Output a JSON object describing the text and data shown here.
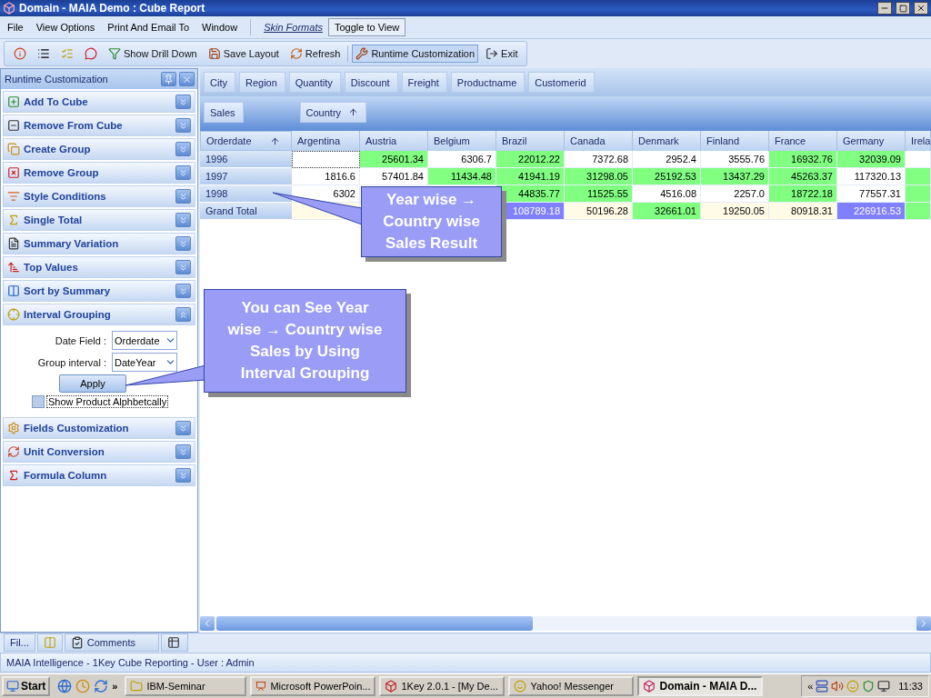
{
  "window": {
    "title": "Domain - MAIA Demo : Cube Report"
  },
  "menu": [
    {
      "label": "File"
    },
    {
      "label": "View Options"
    },
    {
      "label": "Print And Email To"
    },
    {
      "label": "Window"
    }
  ],
  "skin_formats": "Skin Formats",
  "toggle_button": "Toggle to View",
  "toolbar": [
    {
      "label": "Show Drill Down",
      "selected": false
    },
    {
      "label": "Save Layout",
      "selected": false
    },
    {
      "label": "Refresh",
      "selected": false
    },
    {
      "label": "Runtime Customization",
      "selected": true
    },
    {
      "label": "Exit",
      "selected": false
    }
  ],
  "panel": {
    "title": "Runtime Customization",
    "sections": [
      {
        "label": "Add To Cube",
        "expanded": false
      },
      {
        "label": "Remove From Cube",
        "expanded": false
      },
      {
        "label": "Create Group",
        "expanded": false
      },
      {
        "label": "Remove Group",
        "expanded": false
      },
      {
        "label": "Style Conditions",
        "expanded": false
      },
      {
        "label": "Single Total",
        "expanded": false
      },
      {
        "label": "Summary Variation",
        "expanded": false
      },
      {
        "label": "Top Values",
        "expanded": false
      },
      {
        "label": "Sort by Summary",
        "expanded": false
      },
      {
        "label": "Interval Grouping",
        "expanded": true
      },
      {
        "label": "Fields Customization",
        "expanded": false
      },
      {
        "label": "Unit Conversion",
        "expanded": false
      },
      {
        "label": "Formula Column",
        "expanded": false
      }
    ]
  },
  "interval_grouping": {
    "date_field": {
      "label": "Date Field :",
      "value": "Orderdate"
    },
    "group_interval": {
      "label": "Group interval :",
      "value": "DateYear"
    },
    "apply": "Apply",
    "sort_option": {
      "label": "Show Product Alphbetcally",
      "checked": false
    }
  },
  "field_list": [
    "City",
    "Region",
    "Quantity",
    "Discount",
    "Freight",
    "Productname",
    "Customerid"
  ],
  "data_field": "Sales",
  "column_field": "Country",
  "row_field": "Orderdate",
  "grid": {
    "columns": [
      "Argentina",
      "Austria",
      "Belgium",
      "Brazil",
      "Canada",
      "Denmark",
      "Finland",
      "France",
      "Germany",
      "Irela"
    ],
    "rows": [
      {
        "label": "1996",
        "cells": [
          {
            "color": "#ffffff",
            "focused": true
          },
          {
            "value": "25601.34",
            "color": "#80ff80"
          },
          {
            "value": "6306.7",
            "color": "#ffffff"
          },
          {
            "value": "22012.22",
            "color": "#80ff80"
          },
          {
            "value": "7372.68",
            "color": "#ffffff"
          },
          {
            "value": "2952.4",
            "color": "#ffffff"
          },
          {
            "value": "3555.76",
            "color": "#ffffff"
          },
          {
            "value": "16932.76",
            "color": "#80ff80"
          },
          {
            "value": "32039.09",
            "color": "#80ff80"
          },
          {
            "color": "#ffffff"
          }
        ]
      },
      {
        "label": "1997",
        "cells": [
          {
            "value": "1816.6",
            "color": "#ffffff"
          },
          {
            "value": "57401.84",
            "color": "#ffffff"
          },
          {
            "value": "11434.48",
            "color": "#80ff80"
          },
          {
            "value": "41941.19",
            "color": "#80ff80"
          },
          {
            "value": "31298.05",
            "color": "#80ff80"
          },
          {
            "value": "25192.53",
            "color": "#80ff80"
          },
          {
            "value": "13437.29",
            "color": "#80ff80"
          },
          {
            "value": "45263.37",
            "color": "#80ff80"
          },
          {
            "value": "117320.13",
            "color": "#ffffff"
          },
          {
            "color": "#80ff80"
          }
        ]
      },
      {
        "label": "1998",
        "cells": [
          {
            "value": "6302",
            "color": "#ffffff"
          },
          {},
          {},
          {
            "value": "44835.77",
            "color": "#80ff80"
          },
          {
            "value": "11525.55",
            "color": "#80ff80"
          },
          {
            "value": "4516.08",
            "color": "#ffffff"
          },
          {
            "value": "2257.0",
            "color": "#ffffff"
          },
          {
            "value": "18722.18",
            "color": "#80ff80"
          },
          {
            "value": "77557.31",
            "color": "#ffffff"
          },
          {
            "color": "#80ff80"
          }
        ]
      },
      {
        "label": "Grand Total",
        "cells": [
          {
            "color": "#fffbe6"
          },
          {},
          {},
          {
            "value": "108789.18",
            "color": "#8080ff"
          },
          {
            "value": "50196.28",
            "color": "#fffbe6"
          },
          {
            "value": "32661.01",
            "color": "#80ff80"
          },
          {
            "value": "19250.05",
            "color": "#fffbe6"
          },
          {
            "value": "80918.31",
            "color": "#fffbe6"
          },
          {
            "value": "226916.53",
            "color": "#8080ff"
          },
          {
            "color": "#80ff80"
          }
        ]
      }
    ]
  },
  "callouts": [
    {
      "text": "Year wise → Country wise Sales Result"
    },
    {
      "text": "You can See Year wise → Country wise Sales by Using Interval Grouping"
    }
  ],
  "bottom_tabs": [
    {
      "label": "Fil...",
      "selected": false
    },
    {
      "label": "Comments",
      "selected": false
    }
  ],
  "status": "MAIA Intelligence - 1Key Cube Reporting - User : Admin",
  "taskbar": {
    "start": "Start",
    "chevron": "»",
    "tasks": [
      {
        "label": "IBM-Seminar",
        "selected": false
      },
      {
        "label": "Microsoft PowerPoin...",
        "selected": false
      },
      {
        "label": "1Key 2.0.1 - [My De...",
        "selected": false
      },
      {
        "label": "Yahoo! Messenger",
        "selected": false
      },
      {
        "label": "Domain - MAIA D...",
        "selected": true
      }
    ],
    "tray_toggle": "«",
    "clock": "11:33"
  }
}
